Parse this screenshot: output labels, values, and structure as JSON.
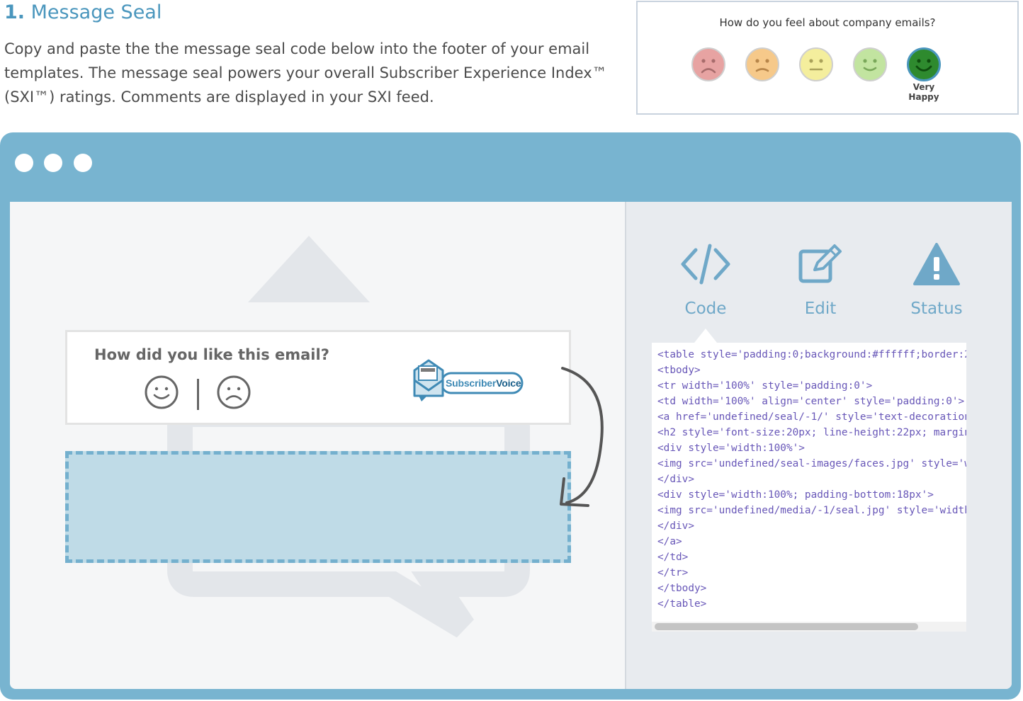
{
  "section": {
    "number": "1.",
    "title": "Message Seal",
    "description": "Copy and paste the  the message seal code below into the footer of your email templates. The message seal powers your overall Subscriber Experience Index™ (SXI™) ratings. Comments are displayed in your SXI feed."
  },
  "rating_preview": {
    "question": "How do you feel about company emails?",
    "faces": [
      {
        "icon": "very-unhappy-face-icon",
        "color": "#e7a3a2"
      },
      {
        "icon": "unhappy-face-icon",
        "color": "#f6c98a"
      },
      {
        "icon": "neutral-face-icon",
        "color": "#f4ee9d"
      },
      {
        "icon": "happy-face-icon",
        "color": "#c2e4a0"
      },
      {
        "icon": "very-happy-face-icon",
        "color": "#2e8a2e"
      }
    ],
    "selected_label_line1": "Very",
    "selected_label_line2": "Happy"
  },
  "toolbar": {
    "code_label": "Code",
    "edit_label": "Edit",
    "status_label": "Status"
  },
  "seal": {
    "question": "How did you like this email?",
    "logo_text_part1": "Subscriber",
    "logo_text_part2": "Voice"
  },
  "code_lines": [
    "<table style='padding:0;background:#ffffff;border:2",
    "<tbody>",
    "<tr width='100%' style='padding:0'>",
    "<td width='100%' align='center' style='padding:0'>",
    "<a href='undefined/seal/-1/' style='text-decoration",
    "<h2 style='font-size:20px; line-height:22px; margin",
    "<div style='width:100%'>",
    "<img src='undefined/seal-images/faces.jpg' style='w",
    "</div>",
    "<div style='width:100%; padding-bottom:18px'>",
    "<img src='undefined/media/-1/seal.jpg' style='width",
    "</div>",
    "</a>",
    "</td>",
    "</tr>",
    "</tbody>",
    "</table>"
  ],
  "colors": {
    "accent": "#4a96bd",
    "browser_frame": "#78b4d0",
    "code_text": "#6857b8",
    "drop_zone_fill": "#bfdbe7"
  }
}
